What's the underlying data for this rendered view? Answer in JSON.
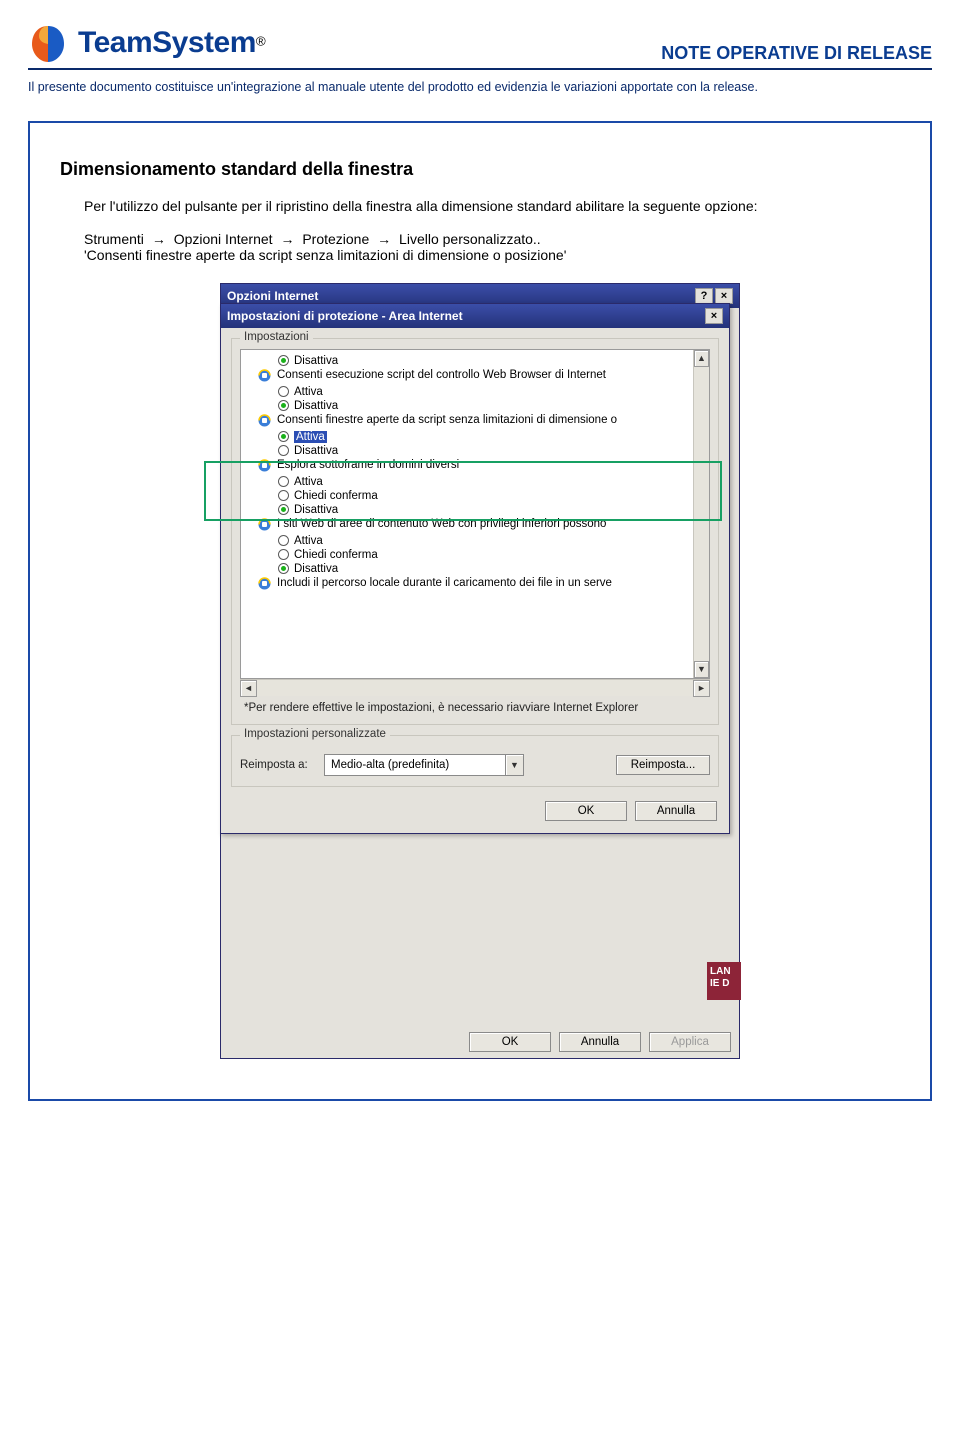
{
  "header": {
    "brand": "TeamSystem",
    "reg": "®",
    "title": "NOTE OPERATIVE DI RELEASE",
    "intro": "Il presente documento costituisce un'integrazione al manuale utente del prodotto ed evidenzia le variazioni apportate con la release."
  },
  "section": {
    "title": "Dimensionamento standard della finestra",
    "para": "Per l'utilizzo del pulsante per il ripristino della finestra alla dimensione standard abilitare la seguente opzione:",
    "path": [
      "Strumenti",
      "Opzioni Internet",
      "Protezione",
      "Livello personalizzato.."
    ],
    "option": "'Consenti finestre aperte da script senza limitazioni di dimensione o posizione'",
    "arrow": "→"
  },
  "back_dialog": {
    "title": "Opzioni Internet",
    "help": "?",
    "close": "×",
    "buttons": {
      "ok": "OK",
      "cancel": "Annulla",
      "apply": "Applica"
    },
    "strip1": "LAN",
    "strip2": "IE D"
  },
  "front_dialog": {
    "title": "Impostazioni di protezione - Area Internet",
    "close": "×",
    "impostazioni_legend": "Impostazioni",
    "note": "*Per rendere effettive le impostazioni, è necessario riavviare Internet Explorer",
    "custom_legend": "Impostazioni personalizzate",
    "reimposta_label": "Reimposta a:",
    "combo_value": "Medio-alta (predefinita)",
    "reimposta_btn": "Reimposta...",
    "buttons": {
      "ok": "OK",
      "cancel": "Annulla"
    },
    "list": [
      {
        "type": "opt",
        "label": "Disattiva",
        "checked": true
      },
      {
        "type": "group",
        "label": "Consenti esecuzione script del controllo Web Browser di Internet"
      },
      {
        "type": "opt",
        "label": "Attiva",
        "checked": false
      },
      {
        "type": "opt",
        "label": "Disattiva",
        "checked": true
      },
      {
        "type": "group",
        "label": "Consenti finestre aperte da script senza limitazioni di dimensione o"
      },
      {
        "type": "opt",
        "label": "Attiva",
        "checked": true,
        "selected": true
      },
      {
        "type": "opt",
        "label": "Disattiva",
        "checked": false
      },
      {
        "type": "group",
        "label": "Esplora sottoframe in domini diversi"
      },
      {
        "type": "opt",
        "label": "Attiva",
        "checked": false
      },
      {
        "type": "opt",
        "label": "Chiedi conferma",
        "checked": false
      },
      {
        "type": "opt",
        "label": "Disattiva",
        "checked": true
      },
      {
        "type": "group",
        "label": "I siti Web di aree di contenuto Web con privilegi inferiori possono"
      },
      {
        "type": "opt",
        "label": "Attiva",
        "checked": false
      },
      {
        "type": "opt",
        "label": "Chiedi conferma",
        "checked": false
      },
      {
        "type": "opt",
        "label": "Disattiva",
        "checked": true
      },
      {
        "type": "group",
        "label": "Includi il percorso locale durante il caricamento dei file in un serve"
      }
    ]
  }
}
